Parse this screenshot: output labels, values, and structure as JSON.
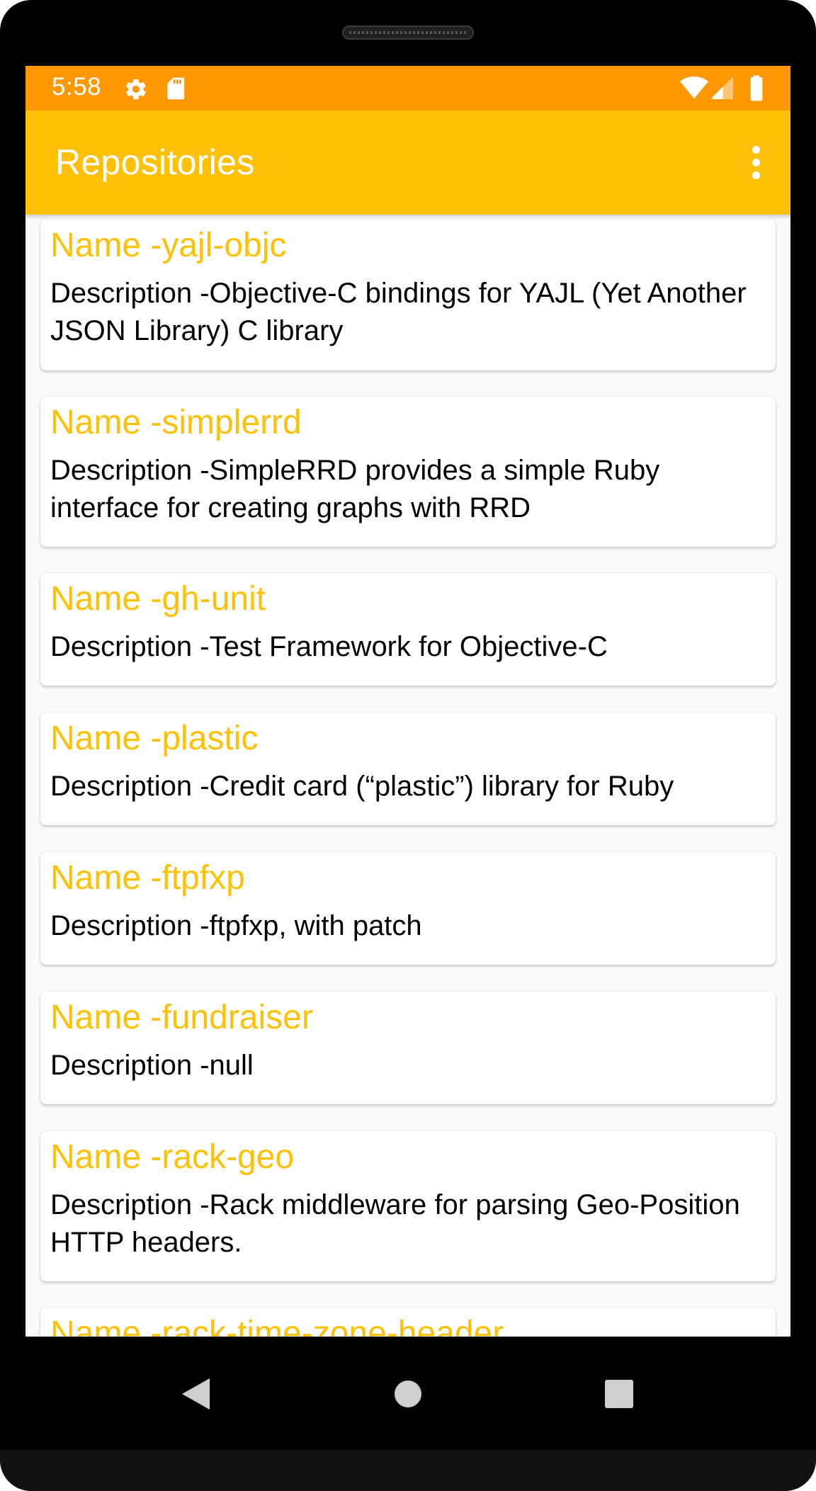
{
  "status_bar": {
    "time": "5:58",
    "icons": [
      "settings-gear-icon",
      "sd-card-icon",
      "wifi-icon",
      "cell-signal-icon",
      "battery-icon"
    ],
    "background": "#ff9800"
  },
  "app_bar": {
    "title": "Repositories",
    "background": "#ffc107",
    "menu_icon": "more-vert-icon"
  },
  "repositories": [
    {
      "name": "Name -yajl-objc",
      "description": "Description -Objective-C bindings for YAJL (Yet Another JSON Library) C library"
    },
    {
      "name": "Name -simplerrd",
      "description": "Description -SimpleRRD provides a simple Ruby interface for creating graphs with RRD"
    },
    {
      "name": "Name -gh-unit",
      "description": "Description -Test Framework for Objective-C"
    },
    {
      "name": "Name -plastic",
      "description": "Description -Credit card (“plastic”) library for Ruby"
    },
    {
      "name": "Name -ftpfxp",
      "description": "Description -ftpfxp, with patch"
    },
    {
      "name": "Name -fundraiser",
      "description": "Description -null"
    },
    {
      "name": "Name -rack-geo",
      "description": "Description -Rack middleware for parsing Geo-Position HTTP headers."
    },
    {
      "name": "Name -rack-time-zone-header",
      "description": ""
    }
  ],
  "colors": {
    "name_text": "#ffc107",
    "description_text": "#000000"
  },
  "nav_bar": {
    "buttons": [
      "back-triangle-icon",
      "home-circle-icon",
      "recents-square-icon"
    ]
  }
}
